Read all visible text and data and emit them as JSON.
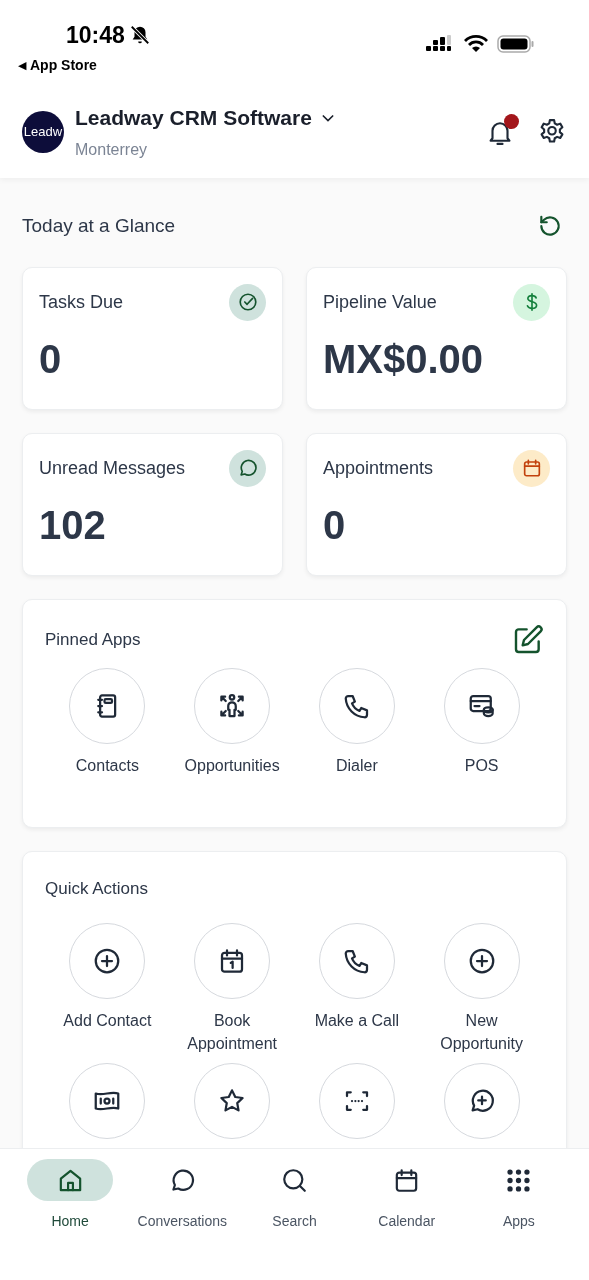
{
  "status_bar": {
    "time": "10:48",
    "back_arrow": "◀",
    "back_label": "App Store"
  },
  "header": {
    "logo_text": "Leadw",
    "title": "Leadway CRM Software",
    "subtitle": "Monterrey",
    "has_unread_notifications": true
  },
  "glance": {
    "title": "Today at a Glance",
    "cards": [
      {
        "label": "Tasks Due",
        "value": "0"
      },
      {
        "label": "Pipeline Value",
        "value": "MX$0.00"
      },
      {
        "label": "Unread Messages",
        "value": "102"
      },
      {
        "label": "Appointments",
        "value": "0"
      }
    ]
  },
  "pinned_apps": {
    "title": "Pinned Apps",
    "apps": [
      {
        "label": "Contacts"
      },
      {
        "label": "Opportunities"
      },
      {
        "label": "Dialer"
      },
      {
        "label": "POS"
      }
    ]
  },
  "quick_actions": {
    "title": "Quick Actions",
    "actions": [
      {
        "kind": "labeled",
        "label": "Add Contact"
      },
      {
        "kind": "labeled",
        "label": "Book Appointment"
      },
      {
        "kind": "labeled",
        "label": "Make a Call"
      },
      {
        "kind": "labeled",
        "label": "New Opportunity"
      },
      {
        "kind": "icon_only"
      },
      {
        "kind": "icon_only"
      },
      {
        "kind": "icon_only"
      },
      {
        "kind": "icon_only"
      }
    ]
  },
  "bottom_nav": [
    {
      "label": "Home",
      "selected": true
    },
    {
      "label": "Conversations",
      "selected": false
    },
    {
      "label": "Search",
      "selected": false
    },
    {
      "label": "Calendar",
      "selected": false
    },
    {
      "label": "Apps",
      "selected": false
    }
  ]
}
